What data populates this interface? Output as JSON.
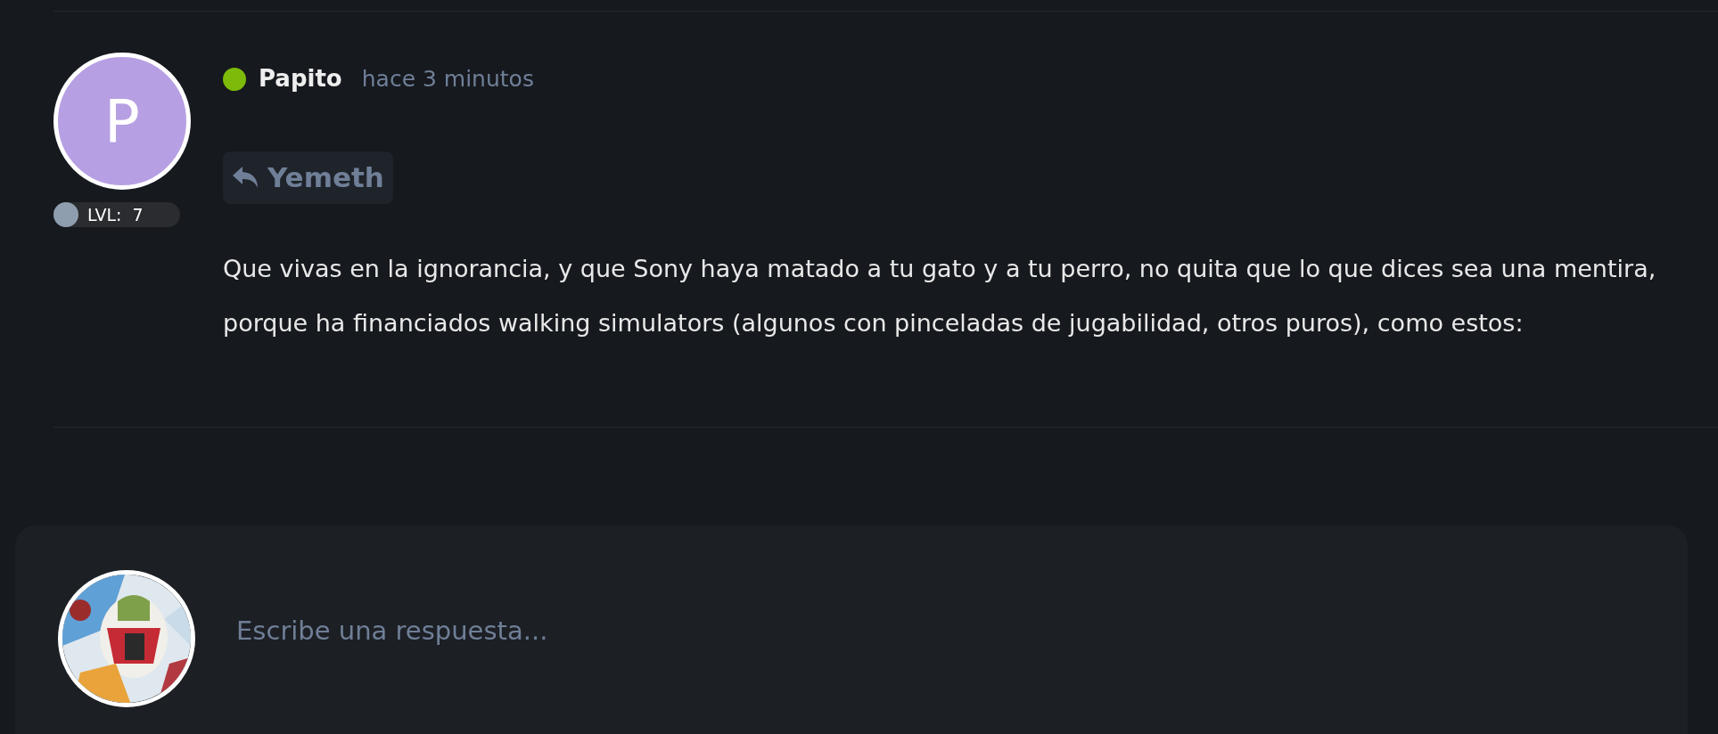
{
  "post": {
    "author": "Papito",
    "online": true,
    "time": "hace 3 minutos",
    "avatar_letter": "P",
    "level_label": "LVL:",
    "level_value": "7",
    "reply_to": "Yemeth",
    "body": "Que vivas en la ignorancia, y que Sony haya matado a tu gato y a tu perro, no quita que lo que dices sea una mentira, porque ha financiados walking simulators (algunos con pinceladas de jugabilidad, otros puros), como estos:"
  },
  "reply_box": {
    "placeholder": "Escribe una respuesta..."
  }
}
